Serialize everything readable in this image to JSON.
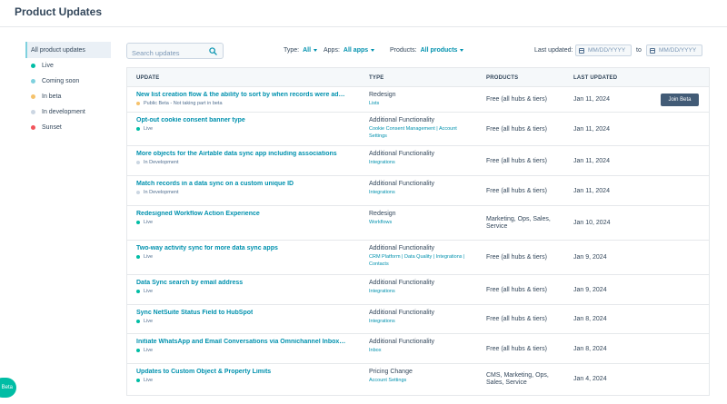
{
  "header": {
    "title": "Product Updates"
  },
  "sidebar": {
    "items": [
      {
        "label": "All product updates",
        "dot": ""
      },
      {
        "label": "Live",
        "dot": "#00bda5"
      },
      {
        "label": "Coming soon",
        "dot": "#7fd1de"
      },
      {
        "label": "In beta",
        "dot": "#f5c26b"
      },
      {
        "label": "In development",
        "dot": "#cbd6e2"
      },
      {
        "label": "Sunset",
        "dot": "#f2545b"
      }
    ]
  },
  "filters": {
    "search_placeholder": "Search updates",
    "type_label": "Type:",
    "type_value": "All",
    "apps_label": "Apps:",
    "apps_value": "All apps",
    "products_label": "Products:",
    "products_value": "All products",
    "last_updated_label": "Last updated:",
    "date_from_placeholder": "MM/DD/YYYY",
    "to_label": "to",
    "date_to_placeholder": "MM/DD/YYYY"
  },
  "table": {
    "headers": [
      "UPDATE",
      "TYPE",
      "PRODUCTS",
      "LAST UPDATED"
    ],
    "rows": [
      {
        "title": "New list creation flow & the ability to sort by when records were added",
        "status": "Public Beta - Not taking part in beta",
        "status_color": "#f5c26b",
        "type": "Redesign",
        "type_sub": "Lists",
        "products": "Free (all hubs & tiers)",
        "date": "Jan 11, 2024",
        "action": "Join Beta"
      },
      {
        "title": "Opt-out cookie consent banner type",
        "status": "Live",
        "status_color": "#00bda5",
        "type": "Additional Functionality",
        "type_sub": "Cookie Consent Management | Account Settings",
        "products": "Free (all hubs & tiers)",
        "date": "Jan 11, 2024",
        "action": ""
      },
      {
        "title": "More objects for the Airtable data sync app including associations",
        "status": "In Development",
        "status_color": "#cbd6e2",
        "type": "Additional Functionality",
        "type_sub": "Integrations",
        "products": "Free (all hubs & tiers)",
        "date": "Jan 11, 2024",
        "action": ""
      },
      {
        "title": "Match records in a data sync on a custom unique ID",
        "status": "In Development",
        "status_color": "#cbd6e2",
        "type": "Additional Functionality",
        "type_sub": "Integrations",
        "products": "Free (all hubs & tiers)",
        "date": "Jan 11, 2024",
        "action": ""
      },
      {
        "title": "Redesigned Workflow Action Experience",
        "status": "Live",
        "status_color": "#00bda5",
        "type": "Redesign",
        "type_sub": "Workflows",
        "products": "Marketing, Ops, Sales, Service",
        "date": "Jan 10, 2024",
        "action": ""
      },
      {
        "title": "Two-way activity sync for more data sync apps",
        "status": "Live",
        "status_color": "#00bda5",
        "type": "Additional Functionality",
        "type_sub": "CRM Platform | Data Quality | Integrations | Contacts",
        "products": "Free (all hubs & tiers)",
        "date": "Jan 9, 2024",
        "action": ""
      },
      {
        "title": "Data Sync search by email address",
        "status": "Live",
        "status_color": "#00bda5",
        "type": "Additional Functionality",
        "type_sub": "Integrations",
        "products": "Free (all hubs & tiers)",
        "date": "Jan 9, 2024",
        "action": ""
      },
      {
        "title": "Sync NetSuite Status Field to HubSpot",
        "status": "Live",
        "status_color": "#00bda5",
        "type": "Additional Functionality",
        "type_sub": "Integrations",
        "products": "Free (all hubs & tiers)",
        "date": "Jan 8, 2024",
        "action": ""
      },
      {
        "title": "Initiate WhatsApp and Email Conversations via Omnichannel Inbox Co...",
        "status": "Live",
        "status_color": "#00bda5",
        "type": "Additional Functionality",
        "type_sub": "Inbox",
        "products": "Free (all hubs & tiers)",
        "date": "Jan 8, 2024",
        "action": ""
      },
      {
        "title": "Updates to Custom Object & Property Limits",
        "status": "Live",
        "status_color": "#00bda5",
        "type": "Pricing Change",
        "type_sub": "Account Settings",
        "products": "CMS, Marketing, Ops, Sales, Service",
        "date": "Jan 4, 2024",
        "action": ""
      }
    ]
  },
  "beta_tab": {
    "label": "Beta"
  }
}
